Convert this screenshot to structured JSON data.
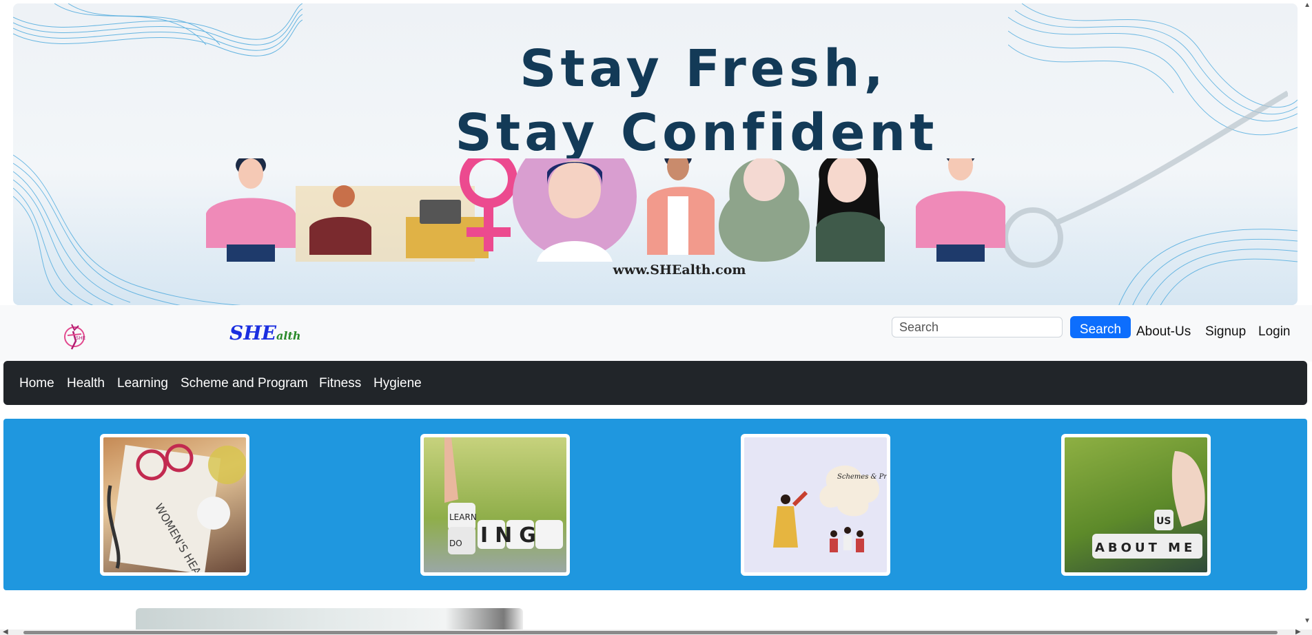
{
  "banner": {
    "title_line1": "Stay Fresh,",
    "title_line2": "Stay Confident",
    "url": "www.SHEalth.com"
  },
  "header": {
    "brand_main": "SHE",
    "brand_suffix": "alth",
    "search_placeholder": "Search",
    "search_button": "Search",
    "links": [
      "About-Us",
      "Signup",
      "Login"
    ]
  },
  "nav": {
    "items": [
      "Home",
      "Health",
      "Learning",
      "Scheme and Program",
      "Fitness",
      "Hygiene"
    ]
  },
  "cards": [
    {
      "image": "womens-health-image",
      "text": "WOMEN'S HEALTH"
    },
    {
      "image": "learning-doing-image",
      "text_top": "LEARN",
      "text_mid": "ING",
      "text_bottom": "DO"
    },
    {
      "image": "schemes-programs-image",
      "text": "Schemes & Programs"
    },
    {
      "image": "about-us-image",
      "text_main": "ABOUT ME",
      "text_top": "US"
    }
  ],
  "colors": {
    "nav_bg": "#212529",
    "strip_bg": "#1f97df",
    "button_bg": "#0d6efd",
    "banner_title": "#133a57"
  }
}
